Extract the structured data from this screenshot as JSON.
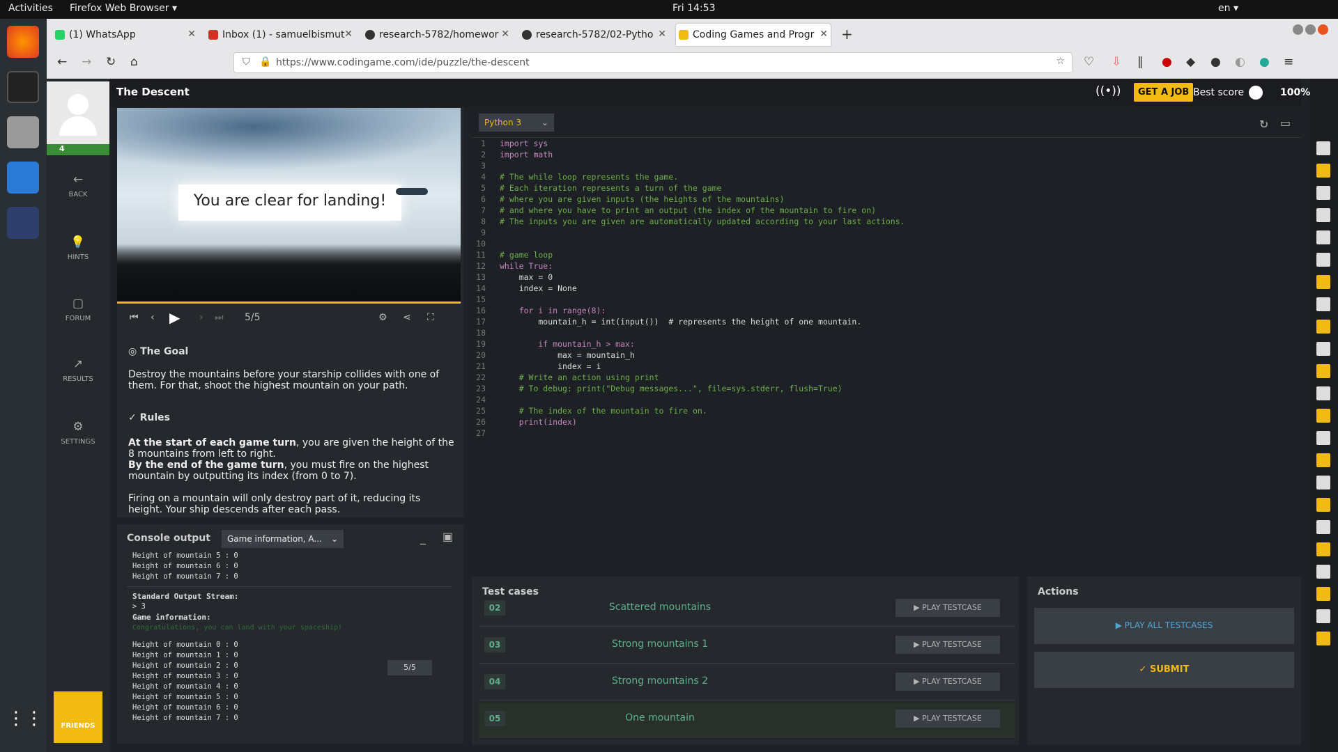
{
  "os": {
    "activities": "Activities",
    "app": "Firefox Web Browser",
    "clock": "Fri 14:53",
    "lang": "en"
  },
  "tabs": [
    {
      "label": "(1) WhatsApp",
      "color": "#25d366"
    },
    {
      "label": "Inbox (1) - samuelbismut",
      "color": "#d93025"
    },
    {
      "label": "research-5782/homewor",
      "color": "#333333"
    },
    {
      "label": "research-5782/02-Pytho",
      "color": "#333333"
    },
    {
      "label": "Coding Games and Progr",
      "color": "#f2bb13"
    }
  ],
  "url": "https://www.codingame.com/ide/puzzle/the-descent",
  "header": {
    "title": "The Descent",
    "get_job": "GET A JOB",
    "best_score": "Best score",
    "pct": "100%"
  },
  "sidebar": {
    "level": "4",
    "items": [
      "BACK",
      "HINTS",
      "FORUM",
      "RESULTS",
      "SETTINGS"
    ],
    "friends": "FRIENDS"
  },
  "viewer": {
    "message": "You are clear for landing!",
    "frame": "5/5"
  },
  "goal": {
    "title": "The Goal",
    "text": "Destroy the mountains before your starship collides with one of them. For that, shoot the highest mountain on your path."
  },
  "rules": {
    "title": "Rules",
    "s1b": "At the start of each game turn",
    "s1": ", you are given the height of the 8 mountains from left to right.",
    "s2b": "By the end of the game turn",
    "s2": ", you must fire on the highest mountain by outputting its index (from 0 to 7).",
    "s3": "Firing on a mountain will only destroy part of it, reducing its height. Your ship descends after each pass."
  },
  "console": {
    "title": "Console output",
    "filter": "Game information, A...",
    "top": [
      "Height of mountain 5 : 0",
      "Height of mountain 6 : 0",
      "Height of mountain 7 : 0"
    ],
    "std_title": "Standard Output Stream:",
    "std_val": "> 3",
    "gi_title": "Game information:",
    "gi_msg": "Congratulations, you can land with your spaceship!",
    "bottom": [
      "Height of mountain 0 : 0",
      "Height of mountain 1 : 0",
      "Height of mountain 2 : 0",
      "Height of mountain 3 : 0",
      "Height of mountain 4 : 0",
      "Height of mountain 5 : 0",
      "Height of mountain 6 : 0",
      "Height of mountain 7 : 0"
    ],
    "turn": "5/5"
  },
  "editor": {
    "language": "Python 3",
    "lines": [
      "import sys",
      "import math",
      "",
      "# The while loop represents the game.",
      "# Each iteration represents a turn of the game",
      "# where you are given inputs (the heights of the mountains)",
      "# and where you have to print an output (the index of the mountain to fire on)",
      "# The inputs you are given are automatically updated according to your last actions.",
      "",
      "",
      "# game loop",
      "while True:",
      "    max = 0",
      "    index = None",
      "",
      "    for i in range(8):",
      "        mountain_h = int(input())  # represents the height of one mountain.",
      "",
      "        if mountain_h > max:",
      "            max = mountain_h",
      "            index = i",
      "    # Write an action using print",
      "    # To debug: print(\"Debug messages...\", file=sys.stderr, flush=True)",
      "",
      "    # The index of the mountain to fire on.",
      "    print(index)",
      ""
    ]
  },
  "tests": {
    "title": "Test cases",
    "rows": [
      {
        "num": "02",
        "name": "Scattered mountains",
        "btn": "▶ PLAY TESTCASE"
      },
      {
        "num": "03",
        "name": "Strong mountains 1",
        "btn": "▶ PLAY TESTCASE"
      },
      {
        "num": "04",
        "name": "Strong mountains 2",
        "btn": "▶ PLAY TESTCASE"
      },
      {
        "num": "05",
        "name": "One mountain",
        "btn": "▶ PLAY TESTCASE"
      }
    ]
  },
  "actions": {
    "title": "Actions",
    "play_all": "▶  PLAY ALL TESTCASES",
    "submit": "✓  SUBMIT"
  },
  "colors": {
    "accent": "#f2bb13",
    "success": "#5fb08a"
  }
}
